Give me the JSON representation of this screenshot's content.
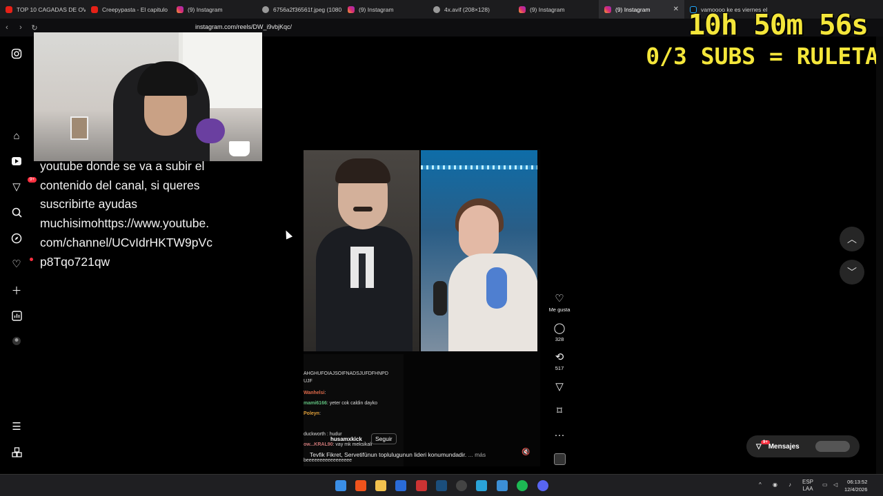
{
  "browser": {
    "tabs": [
      {
        "label": "TOP 10 CAGADAS DE OVE",
        "icon": "youtube-icon"
      },
      {
        "label": "Creepypasta - El capitulo",
        "icon": "youtube-icon"
      },
      {
        "label": "(9) Instagram",
        "icon": "instagram-icon"
      },
      {
        "label": "6756a2f36561f.jpeg (1080",
        "icon": "globe-icon"
      },
      {
        "label": "(9) Instagram",
        "icon": "instagram-icon"
      },
      {
        "label": "4x.avif (208×128)",
        "icon": "globe-icon"
      },
      {
        "label": "(9) Instagram",
        "icon": "instagram-icon"
      },
      {
        "label": "(9) Instagram",
        "icon": "instagram-icon",
        "active": true
      },
      {
        "label": "vamoooo ke es viernes el",
        "icon": "tiktok-icon"
      }
    ],
    "url": "instagram.com/reels/DW_i9vbjKqc/"
  },
  "stream_overlay": {
    "timer": "10h 50m 56s",
    "subs": "0/3 SUBS = RULETA"
  },
  "sidebar": {
    "notifications_badge": "9+"
  },
  "description": {
    "lines": [
      "youtube donde se va a subir el",
      "contenido del canal, si queres",
      "suscribirte ayudas",
      "muchisimohttps://www.youtube.",
      "com/channel/UCvIdrHKTW9pVc",
      "p8Tqo721qw"
    ]
  },
  "reel": {
    "chat": [
      {
        "name": "",
        "text": "AHGHUFOIAJSOIFNADSJUFDFHNPD"
      },
      {
        "name": "",
        "text": "UJF"
      },
      {
        "name": "Wanhelsi",
        "text": ": "
      },
      {
        "name": "mami6166",
        "text": ": yeter cok caldin dayko"
      },
      {
        "name": "Poleyn",
        "text": ": "
      },
      {
        "name": "",
        "text": ""
      },
      {
        "name": "",
        "text": "duckworth : hudur"
      },
      {
        "name": "ow...KRAL90",
        "text": ": vay mk meksikali"
      },
      {
        "name": "",
        "text": "beeeeeeeeeeeeeeeee"
      }
    ],
    "author": "husamxkick",
    "follow_label": "Seguir",
    "caption": "Tevfik Fikret, Servetifünun toplulugunun lideri konumundadir.",
    "caption_more": "... más"
  },
  "actions": {
    "like_label": "Me gusta",
    "comments_count": "328",
    "reposts_count": "517"
  },
  "messages": {
    "label": "Mensajes",
    "badge": "9+"
  },
  "taskbar": {
    "language": "ESP",
    "language_sub": "LAA",
    "time": "06:13:52",
    "date": "12/4/2026"
  },
  "colors": {
    "overlay_yellow": "#f4e63a",
    "badge_red": "#ff3040",
    "background": "#000000"
  }
}
